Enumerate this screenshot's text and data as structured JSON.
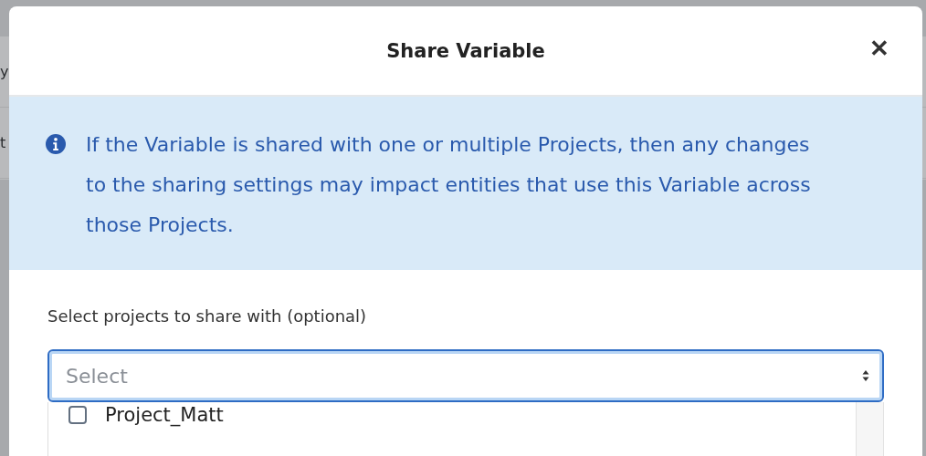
{
  "background": {
    "cells": [
      "y",
      "t"
    ]
  },
  "dialog": {
    "title": "Share Variable",
    "close": "✕"
  },
  "notice": {
    "text": "If the Variable is shared with one or multiple Projects, then any changes to the sharing settings may impact entities that use this Variable across those Projects."
  },
  "field": {
    "label": "Select projects to share with (optional)",
    "placeholder": "Select",
    "focused": true
  },
  "options": [
    {
      "label": "Project_Matt",
      "checked": false
    }
  ]
}
